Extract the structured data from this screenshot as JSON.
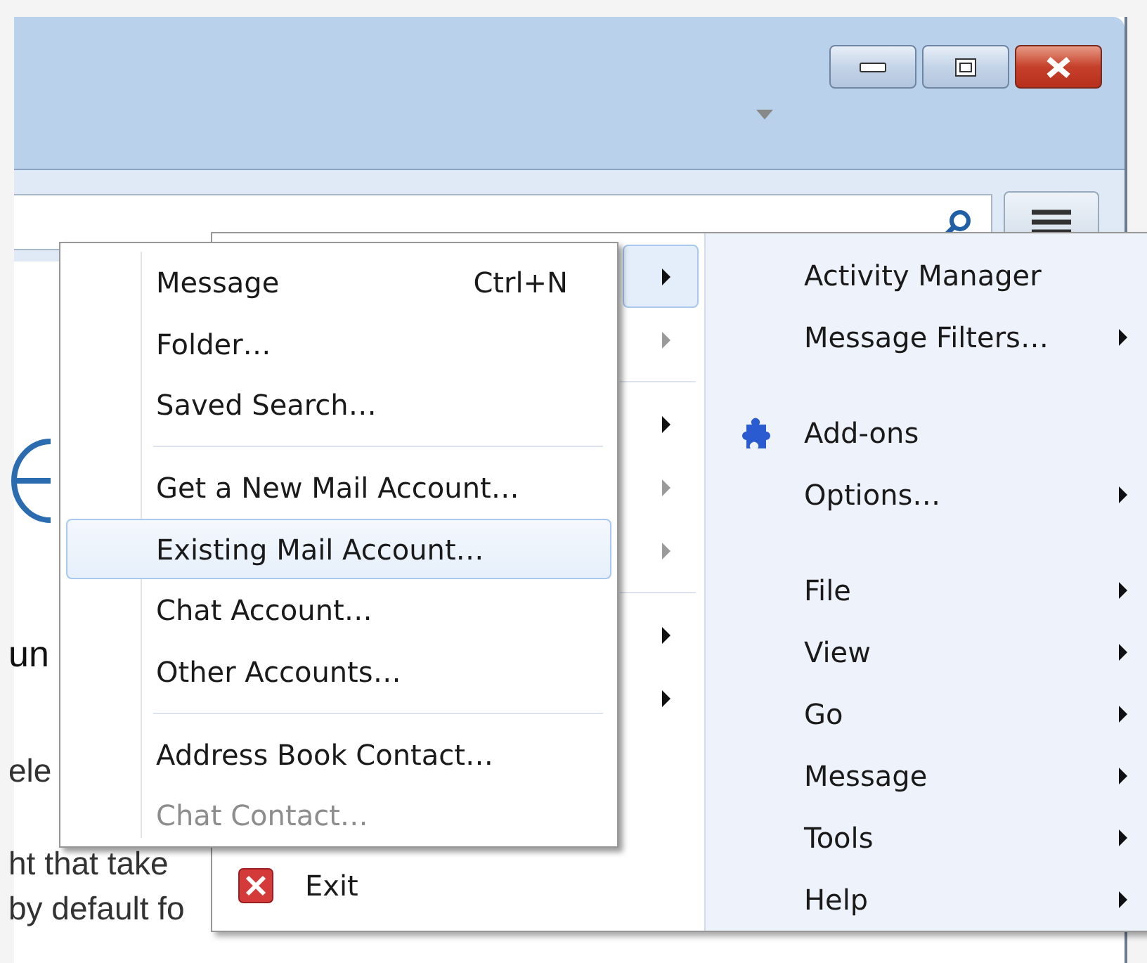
{
  "background_text": [
    "un",
    "ele",
    "ht that take",
    "by default fo"
  ],
  "main_menu": {
    "left_groups": [
      [
        {
          "selected": true,
          "disabled": false
        },
        {
          "selected": false,
          "disabled": true
        }
      ],
      [
        {
          "selected": false,
          "disabled": false
        },
        {
          "selected": false,
          "disabled": true
        },
        {
          "selected": false,
          "disabled": true
        }
      ],
      [
        {
          "selected": false,
          "disabled": false
        },
        {
          "selected": false,
          "disabled": false
        }
      ]
    ],
    "exit": {
      "label": "Exit"
    },
    "right_groups": [
      [
        {
          "label": "Activity Manager",
          "submenu": false,
          "has_icon": false
        },
        {
          "label": "Message Filters…",
          "submenu": true,
          "has_icon": false
        }
      ],
      [
        {
          "label": "Add-ons",
          "submenu": false,
          "has_icon": true
        },
        {
          "label": "Options…",
          "submenu": true,
          "has_icon": false
        }
      ],
      [
        {
          "label": "File",
          "submenu": true,
          "has_icon": false
        },
        {
          "label": "View",
          "submenu": true,
          "has_icon": false
        },
        {
          "label": "Go",
          "submenu": true,
          "has_icon": false
        },
        {
          "label": "Message",
          "submenu": true,
          "has_icon": false
        },
        {
          "label": "Tools",
          "submenu": true,
          "has_icon": false
        },
        {
          "label": "Help",
          "submenu": true,
          "has_icon": false
        }
      ]
    ]
  },
  "new_submenu": [
    [
      {
        "label": "Message",
        "shortcut": "Ctrl+N",
        "selected": false,
        "disabled": false
      },
      {
        "label": "Folder…",
        "selected": false,
        "disabled": false
      },
      {
        "label": "Saved Search…",
        "selected": false,
        "disabled": false
      }
    ],
    [
      {
        "label": "Get a New Mail Account…",
        "selected": false,
        "disabled": false
      },
      {
        "label": "Existing Mail Account…",
        "selected": true,
        "disabled": false
      },
      {
        "label": "Chat Account…",
        "selected": false,
        "disabled": false
      },
      {
        "label": "Other Accounts…",
        "selected": false,
        "disabled": false
      }
    ],
    [
      {
        "label": "Address Book Contact…",
        "selected": false,
        "disabled": false
      },
      {
        "label": "Chat Contact…",
        "selected": false,
        "disabled": true
      }
    ]
  ]
}
